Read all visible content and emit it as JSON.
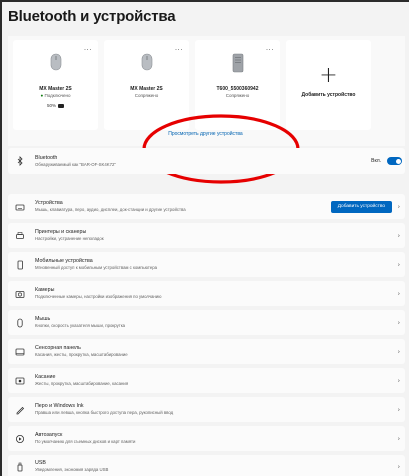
{
  "page": {
    "title": "Bluetooth и устройства"
  },
  "devices": [
    {
      "name": "MX Master 2S",
      "status": "Подключено",
      "battery": "50%",
      "icon": "mouse-icon",
      "connected": true
    },
    {
      "name": "MX Master 2S",
      "status": "Сопряжено",
      "icon": "mouse-icon",
      "connected": false
    },
    {
      "name": "T600_5500360942",
      "status": "Сопряжено",
      "icon": "speaker-icon",
      "connected": false
    }
  ],
  "card_more": "...",
  "add_card": {
    "plus": "+",
    "label": "Добавить устройство"
  },
  "view_more": "Просмотреть другие устройства",
  "colors": {
    "accent": "#0067c0",
    "link": "#0063b1",
    "annotation": "#e60000",
    "connected": "#0f7b0f"
  },
  "bluetooth": {
    "title": "Bluetooth",
    "subtitle": "Обнаруживаемый как \"BAR-OF-SK4K72\"",
    "toggle_label": "Вкл.",
    "enabled": true
  },
  "settings": [
    {
      "title": "Устройства",
      "subtitle": "Мышь, клавиатура, перо, аудио, дисплеи, док-станции и другие устройства",
      "button": "Добавить устройство",
      "icon": "keyboard-icon"
    },
    {
      "title": "Принтеры и сканеры",
      "subtitle": "Настройки, устранение неполадок",
      "icon": "printer-icon"
    },
    {
      "title": "Мобильные устройства",
      "subtitle": "Мгновенный доступ к мобильным устройствам с компьютера",
      "icon": "phone-icon"
    },
    {
      "title": "Камеры",
      "subtitle": "Подключенные камеры, настройки изображения по умолчанию",
      "icon": "camera-icon"
    },
    {
      "title": "Мышь",
      "subtitle": "Кнопки, скорость указателя мыши, прокрутка",
      "icon": "mouse-icon"
    },
    {
      "title": "Сенсорная панель",
      "subtitle": "Касания, жесты, прокрутка, масштабирование",
      "icon": "touchpad-icon"
    },
    {
      "title": "Касание",
      "subtitle": "Жесты, прокрутка, масштабирование, касания",
      "icon": "touch-icon"
    },
    {
      "title": "Перо и Windows Ink",
      "subtitle": "Правша или левша, кнопка быстрого доступа пера, рукописный ввод",
      "icon": "pen-icon"
    },
    {
      "title": "Автозапуск",
      "subtitle": "По умолчанию для съемных дисков и карт памяти",
      "icon": "autoplay-icon"
    },
    {
      "title": "USB",
      "subtitle": "Уведомления, экономия заряда USB",
      "icon": "usb-icon"
    }
  ],
  "chevron": "›"
}
